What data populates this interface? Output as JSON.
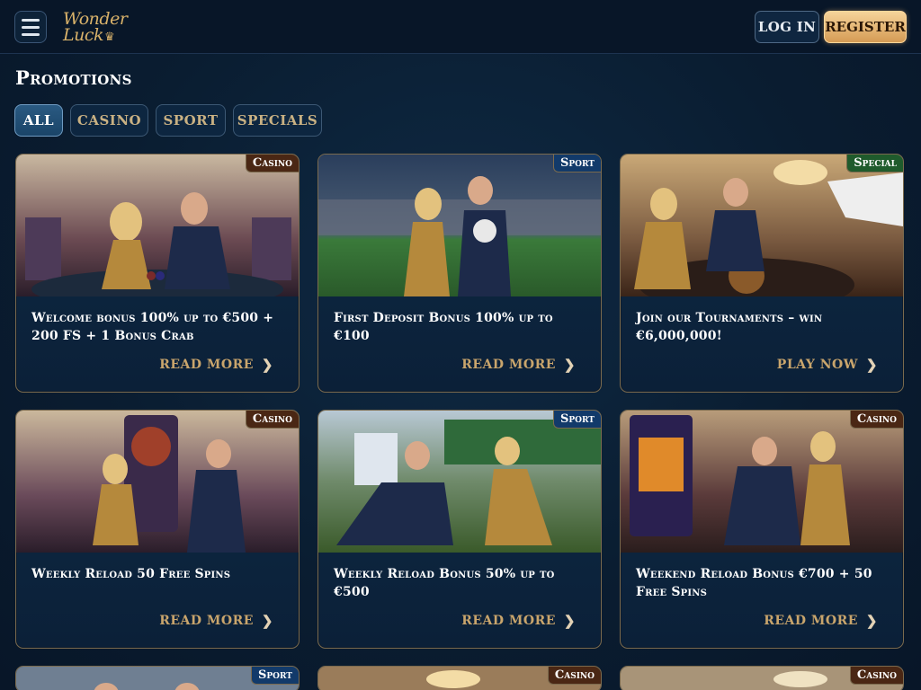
{
  "header": {
    "logo_line1": "Wonder",
    "logo_line2": "Luck",
    "login_label": "LOG IN",
    "register_label": "REGISTER"
  },
  "page_title": "Promotions",
  "tabs": [
    {
      "label": "ALL",
      "active": true
    },
    {
      "label": "CASINO",
      "active": false
    },
    {
      "label": "SPORT",
      "active": false
    },
    {
      "label": "SPECIALS",
      "active": false
    }
  ],
  "promotions": [
    {
      "badge": "Casino",
      "title": "Welcome bonus 100% up to €500 + 200 FS + 1 Bonus Crab",
      "cta": "READ MORE"
    },
    {
      "badge": "Sport",
      "title": "First Deposit Bonus 100% up to €100",
      "cta": "READ MORE"
    },
    {
      "badge": "Special",
      "title": "Join our Tournaments – win €6,000,000!",
      "cta": "PLAY NOW"
    },
    {
      "badge": "Casino",
      "title": "Weekly Reload 50 Free Spins",
      "cta": "READ MORE"
    },
    {
      "badge": "Sport",
      "title": "Weekly Reload Bonus 50% up to €500",
      "cta": "READ MORE"
    },
    {
      "badge": "Casino",
      "title": "Weekend Reload Bonus €700 + 50 Free Spins",
      "cta": "READ MORE"
    },
    {
      "badge": "Sport"
    },
    {
      "badge": "Casino"
    },
    {
      "badge": "Casino"
    }
  ],
  "colors": {
    "background": "#0a1d31",
    "accent_gold": "#d59b55",
    "cta_gold": "#c9a56c",
    "badge_casino": "#4a2714",
    "badge_sport": "#123a6a",
    "badge_special": "#1f5b2c"
  },
  "icons": {
    "menu": "hamburger-icon",
    "chevron": "chevron-right-icon",
    "logo_crown": "crown-icon"
  }
}
